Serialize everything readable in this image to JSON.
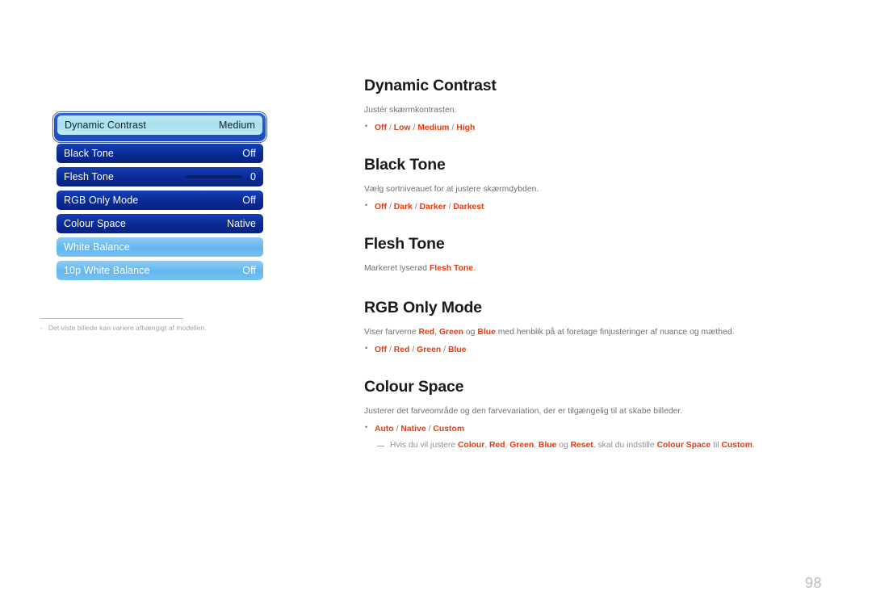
{
  "page": {
    "number": "98",
    "language": "da"
  },
  "osd_menu": {
    "note_marker": "-",
    "note_text": "Det viste billede kan variere afhængigt af modellen.",
    "rows": [
      {
        "label": "Dynamic Contrast",
        "value": "Medium",
        "state": "selected",
        "has_slider": false
      },
      {
        "label": "Black Tone",
        "value": "Off",
        "state": "normal",
        "has_slider": false
      },
      {
        "label": "Flesh Tone",
        "value": "0",
        "state": "normal",
        "has_slider": true
      },
      {
        "label": "RGB Only Mode",
        "value": "Off",
        "state": "normal",
        "has_slider": false
      },
      {
        "label": "Colour Space",
        "value": "Native",
        "state": "normal",
        "has_slider": false
      },
      {
        "label": "White Balance",
        "value": "",
        "state": "light",
        "has_slider": false
      },
      {
        "label": "10p White Balance",
        "value": "Off",
        "state": "light",
        "has_slider": false
      }
    ]
  },
  "sections": {
    "dynamic_contrast": {
      "title": "Dynamic Contrast",
      "description": "Justér skærmkontrasten.",
      "options": [
        "Off",
        "Low",
        "Medium",
        "High"
      ]
    },
    "black_tone": {
      "title": "Black Tone",
      "description": "Vælg sortniveauet for at justere skærmdybden.",
      "options": [
        "Off",
        "Dark",
        "Darker",
        "Darkest"
      ]
    },
    "flesh_tone": {
      "title": "Flesh Tone",
      "desc_pre": "Markeret lyserød ",
      "desc_hl": "Flesh Tone",
      "desc_post": "."
    },
    "rgb_only_mode": {
      "title": "RGB Only Mode",
      "desc_p1": "Viser farverne ",
      "desc_hl1": "Red",
      "desc_p2": ", ",
      "desc_hl2": "Green",
      "desc_p3": " og ",
      "desc_hl3": "Blue",
      "desc_p4": " med henblik på at foretage finjusteringer af nuance og mæthed.",
      "options": [
        "Off",
        "Red",
        "Green",
        "Blue"
      ]
    },
    "colour_space": {
      "title": "Colour Space",
      "description": "Justerer det farveområde og den farvevariation, der er tilgængelig til at skabe billeder.",
      "options": [
        "Auto",
        "Native",
        "Custom"
      ],
      "note_p1": "Hvis du vil justere ",
      "note_hl1": "Colour",
      "note_p2": ", ",
      "note_hl2": "Red",
      "note_p3": ", ",
      "note_hl3": "Green",
      "note_p4": ", ",
      "note_hl4": "Blue",
      "note_p5": " og ",
      "note_hl5": "Reset",
      "note_p6": ", skal du indstille ",
      "note_hl6": "Colour Space",
      "note_p7": " til ",
      "note_hl7": "Custom",
      "note_p8": "."
    }
  },
  "separator": "/",
  "colors": {
    "option_red": "#e8380d",
    "menu_navy": "#0a2a94",
    "menu_light_blue": "#63b6ef",
    "menu_selected": "#a8dfef"
  }
}
